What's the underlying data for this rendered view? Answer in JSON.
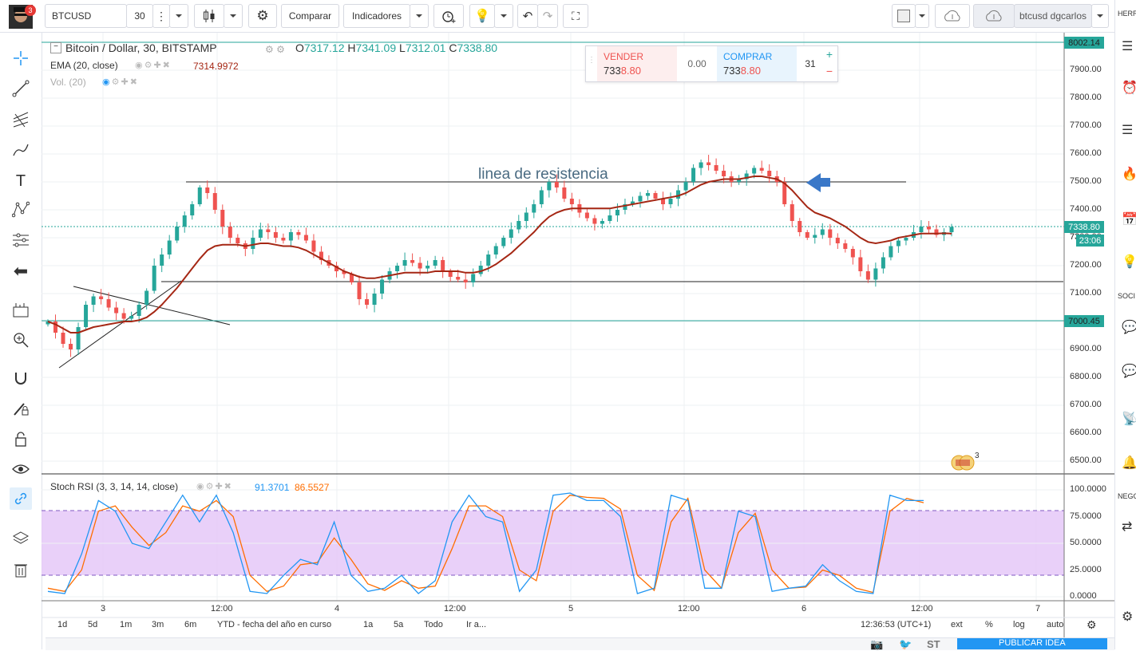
{
  "topbar": {
    "symbol": "BTCUSD",
    "interval": "30",
    "compare_label": "Comparar",
    "indicators_label": "Indicadores",
    "account_label": "btcusd dgcarlos",
    "notification_count": "3"
  },
  "legend": {
    "title": "Bitcoin / Dollar, 30, BITSTAMP",
    "o_label": "O",
    "o_value": "7317.12",
    "h_label": "H",
    "h_value": "7341.09",
    "l_label": "L",
    "l_value": "7312.01",
    "c_label": "C",
    "c_value": "7338.80",
    "ema_label": "EMA (20, close)",
    "ema_value": "7314.9972",
    "vol_label": "Vol. (20)"
  },
  "trade": {
    "sell_label": "VENDER",
    "sell_price_a": "733",
    "sell_price_b": "8.80",
    "spread": "0.00",
    "buy_label": "COMPRAR",
    "buy_price_a": "733",
    "buy_price_b": "8.80",
    "qty": "31"
  },
  "annotation": {
    "text": "linea de resistencia"
  },
  "price_axis": {
    "ticks": [
      "7900.00",
      "7800.00",
      "7700.00",
      "7600.00",
      "7500.00",
      "7400.00",
      "7300.00",
      "7200.00",
      "7100.00",
      "6900.00",
      "6800.00",
      "6700.00",
      "6600.00",
      "6500.00"
    ],
    "tag_high": "8002.14",
    "tag_last": "7338.80",
    "tag_countdown": "23:06",
    "tag_level": "7000.45",
    "tag_partial": "73"
  },
  "stoch": {
    "label": "Stoch RSI (3, 3, 14, 14, close)",
    "k_value": "91.3701",
    "d_value": "86.5527",
    "ticks": [
      "100.0000",
      "75.0000",
      "50.0000",
      "25.0000",
      "0.0000"
    ]
  },
  "time_axis": {
    "labels": [
      "3",
      "12:00",
      "4",
      "12:00",
      "5",
      "12:00",
      "6",
      "12:00",
      "7"
    ]
  },
  "bottombar": {
    "ranges": [
      "1d",
      "5d",
      "1m",
      "3m",
      "6m",
      "YTD - fecha del año en curso",
      "1a",
      "5a",
      "Todo",
      "Ir a..."
    ],
    "clock": "12:36:53 (UTC+1)",
    "ext": "ext",
    "pct": "%",
    "log": "log",
    "auto": "auto"
  },
  "footer": {
    "publish_label": "PUBLICAR IDEA"
  },
  "sidebar": {
    "herr": "HERRA",
    "soci": "SOCI",
    "nego": "NEGOC"
  },
  "event_badge": "3",
  "colors": {
    "up": "#26a69a",
    "down": "#ef5350",
    "ema": "#a52714",
    "stoch_k": "#2196f3",
    "stoch_d": "#ff6d00",
    "band": "#e1bef7"
  },
  "chart_data": {
    "type": "candlestick",
    "time_labels": [
      "3",
      "12:00",
      "4",
      "12:00",
      "5",
      "12:00",
      "6",
      "12:00",
      "7"
    ],
    "ylim": [
      6450,
      8050
    ],
    "close_series_approx": [
      7000,
      6960,
      6920,
      6900,
      6980,
      7060,
      7090,
      7080,
      7050,
      7030,
      7010,
      7020,
      7060,
      7110,
      7200,
      7240,
      7290,
      7340,
      7380,
      7420,
      7480,
      7460,
      7400,
      7340,
      7300,
      7280,
      7260,
      7300,
      7330,
      7320,
      7300,
      7290,
      7320,
      7310,
      7290,
      7250,
      7220,
      7200,
      7180,
      7170,
      7140,
      7080,
      7060,
      7100,
      7150,
      7180,
      7200,
      7220,
      7210,
      7190,
      7200,
      7220,
      7180,
      7160,
      7150,
      7140,
      7170,
      7200,
      7240,
      7270,
      7300,
      7330,
      7360,
      7390,
      7420,
      7470,
      7500,
      7480,
      7440,
      7420,
      7390,
      7370,
      7350,
      7360,
      7380,
      7400,
      7420,
      7430,
      7450,
      7460,
      7440,
      7420,
      7440,
      7470,
      7500,
      7550,
      7570,
      7560,
      7540,
      7520,
      7500,
      7510,
      7530,
      7550,
      7540,
      7520,
      7500,
      7420,
      7360,
      7320,
      7300,
      7310,
      7330,
      7300,
      7280,
      7260,
      7230,
      7180,
      7150,
      7190,
      7230,
      7270,
      7290,
      7300,
      7320,
      7340,
      7330,
      7310,
      7320,
      7338.8
    ],
    "ema_approx": [
      7000,
      6990,
      6975,
      6960,
      6960,
      6970,
      6980,
      6985,
      6990,
      6995,
      7000,
      7000,
      7005,
      7015,
      7035,
      7060,
      7090,
      7120,
      7155,
      7190,
      7225,
      7255,
      7270,
      7275,
      7275,
      7275,
      7270,
      7275,
      7280,
      7280,
      7275,
      7270,
      7270,
      7265,
      7255,
      7240,
      7225,
      7210,
      7195,
      7180,
      7170,
      7160,
      7155,
      7155,
      7160,
      7165,
      7170,
      7175,
      7175,
      7175,
      7175,
      7180,
      7180,
      7180,
      7180,
      7175,
      7175,
      7180,
      7190,
      7205,
      7225,
      7245,
      7270,
      7295,
      7320,
      7350,
      7375,
      7390,
      7400,
      7405,
      7405,
      7405,
      7405,
      7405,
      7405,
      7410,
      7415,
      7420,
      7425,
      7430,
      7435,
      7440,
      7445,
      7450,
      7460,
      7475,
      7490,
      7500,
      7505,
      7510,
      7510,
      7510,
      7515,
      7520,
      7520,
      7515,
      7510,
      7495,
      7470,
      7440,
      7410,
      7390,
      7380,
      7370,
      7355,
      7340,
      7320,
      7300,
      7285,
      7280,
      7285,
      7290,
      7300,
      7305,
      7310,
      7315,
      7315,
      7315,
      7316,
      7315
    ],
    "stoch_k_approx": [
      5,
      3,
      40,
      90,
      80,
      50,
      45,
      70,
      95,
      70,
      95,
      60,
      5,
      3,
      20,
      35,
      30,
      70,
      20,
      5,
      8,
      20,
      3,
      15,
      70,
      95,
      75,
      70,
      5,
      25,
      95,
      97,
      90,
      90,
      75,
      3,
      8,
      95,
      90,
      8,
      8,
      80,
      75,
      5,
      8,
      10,
      30,
      15,
      5,
      3,
      95,
      90,
      90
    ],
    "stoch_d_approx": [
      8,
      5,
      25,
      80,
      85,
      65,
      48,
      60,
      85,
      80,
      90,
      75,
      20,
      5,
      10,
      30,
      32,
      55,
      35,
      12,
      6,
      15,
      8,
      10,
      45,
      85,
      85,
      75,
      25,
      15,
      80,
      95,
      93,
      92,
      82,
      20,
      6,
      70,
      92,
      25,
      8,
      60,
      78,
      25,
      8,
      9,
      25,
      20,
      8,
      4,
      80,
      92,
      88
    ]
  }
}
